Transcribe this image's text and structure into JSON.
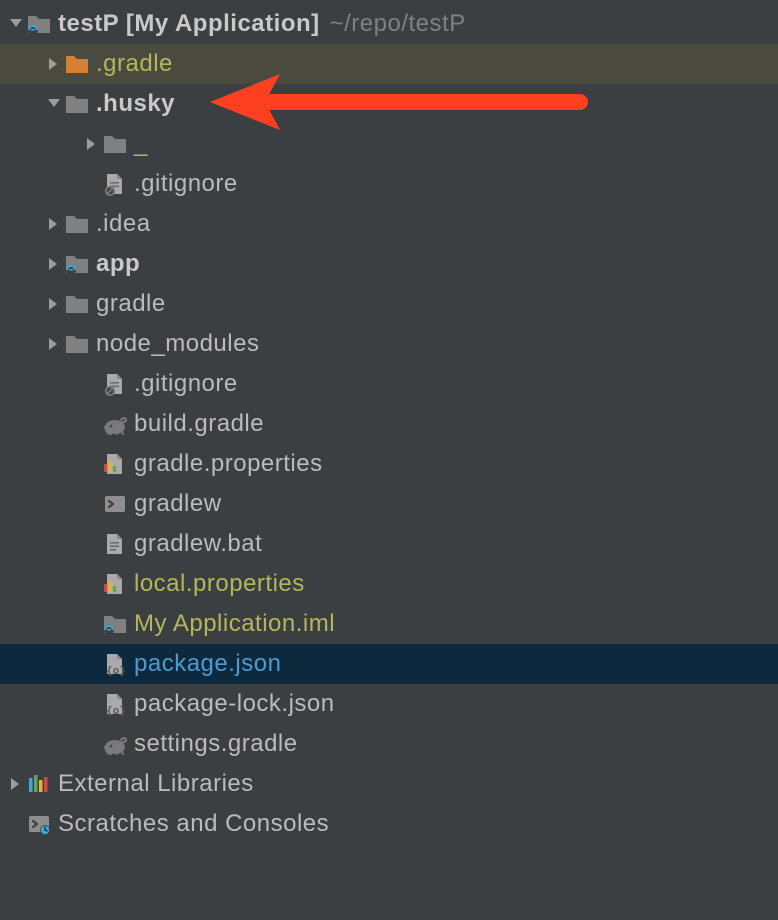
{
  "tree": {
    "root": {
      "name": "testP",
      "module": "[My Application]",
      "path": "~/repo/testP"
    },
    "items": [
      {
        "depth": 0,
        "arrow": "down",
        "icon": "project-folder",
        "text": "testP",
        "bold": true,
        "isRoot": true
      },
      {
        "depth": 1,
        "arrow": "right",
        "icon": "folder-orange",
        "text": ".gradle",
        "color": "olive",
        "highlight": "olive"
      },
      {
        "depth": 1,
        "arrow": "down",
        "icon": "folder-gray",
        "text": ".husky",
        "bold": true,
        "annotation": "arrow"
      },
      {
        "depth": 2,
        "arrow": "right",
        "icon": "folder-gray",
        "text": "_",
        "color": "olive"
      },
      {
        "depth": 2,
        "arrow": "",
        "icon": "file-ignored",
        "text": ".gitignore"
      },
      {
        "depth": 1,
        "arrow": "right",
        "icon": "folder-gray",
        "text": ".idea"
      },
      {
        "depth": 1,
        "arrow": "right",
        "icon": "project-folder",
        "text": "app",
        "bold": true
      },
      {
        "depth": 1,
        "arrow": "right",
        "icon": "folder-gray",
        "text": "gradle"
      },
      {
        "depth": 1,
        "arrow": "right",
        "icon": "folder-gray",
        "text": "node_modules"
      },
      {
        "depth": 2,
        "arrow": "",
        "icon": "file-ignored",
        "text": ".gitignore"
      },
      {
        "depth": 2,
        "arrow": "",
        "icon": "gradle-elephant",
        "text": "build.gradle"
      },
      {
        "depth": 2,
        "arrow": "",
        "icon": "properties",
        "text": "gradle.properties"
      },
      {
        "depth": 2,
        "arrow": "",
        "icon": "shell",
        "text": "gradlew"
      },
      {
        "depth": 2,
        "arrow": "",
        "icon": "file-generic",
        "text": "gradlew.bat"
      },
      {
        "depth": 2,
        "arrow": "",
        "icon": "properties",
        "text": "local.properties",
        "color": "olive"
      },
      {
        "depth": 2,
        "arrow": "",
        "icon": "project-folder",
        "text": "My Application.iml",
        "color": "olive"
      },
      {
        "depth": 2,
        "arrow": "",
        "icon": "json-file",
        "text": "package.json",
        "color": "blue",
        "highlight": "blue"
      },
      {
        "depth": 2,
        "arrow": "",
        "icon": "json-file",
        "text": "package-lock.json"
      },
      {
        "depth": 2,
        "arrow": "",
        "icon": "gradle-elephant",
        "text": "settings.gradle"
      },
      {
        "depth": 0,
        "arrow": "right",
        "icon": "libraries",
        "text": "External Libraries"
      },
      {
        "depth": 0,
        "arrow": "",
        "icon": "scratches",
        "text": "Scratches and Consoles"
      }
    ]
  }
}
